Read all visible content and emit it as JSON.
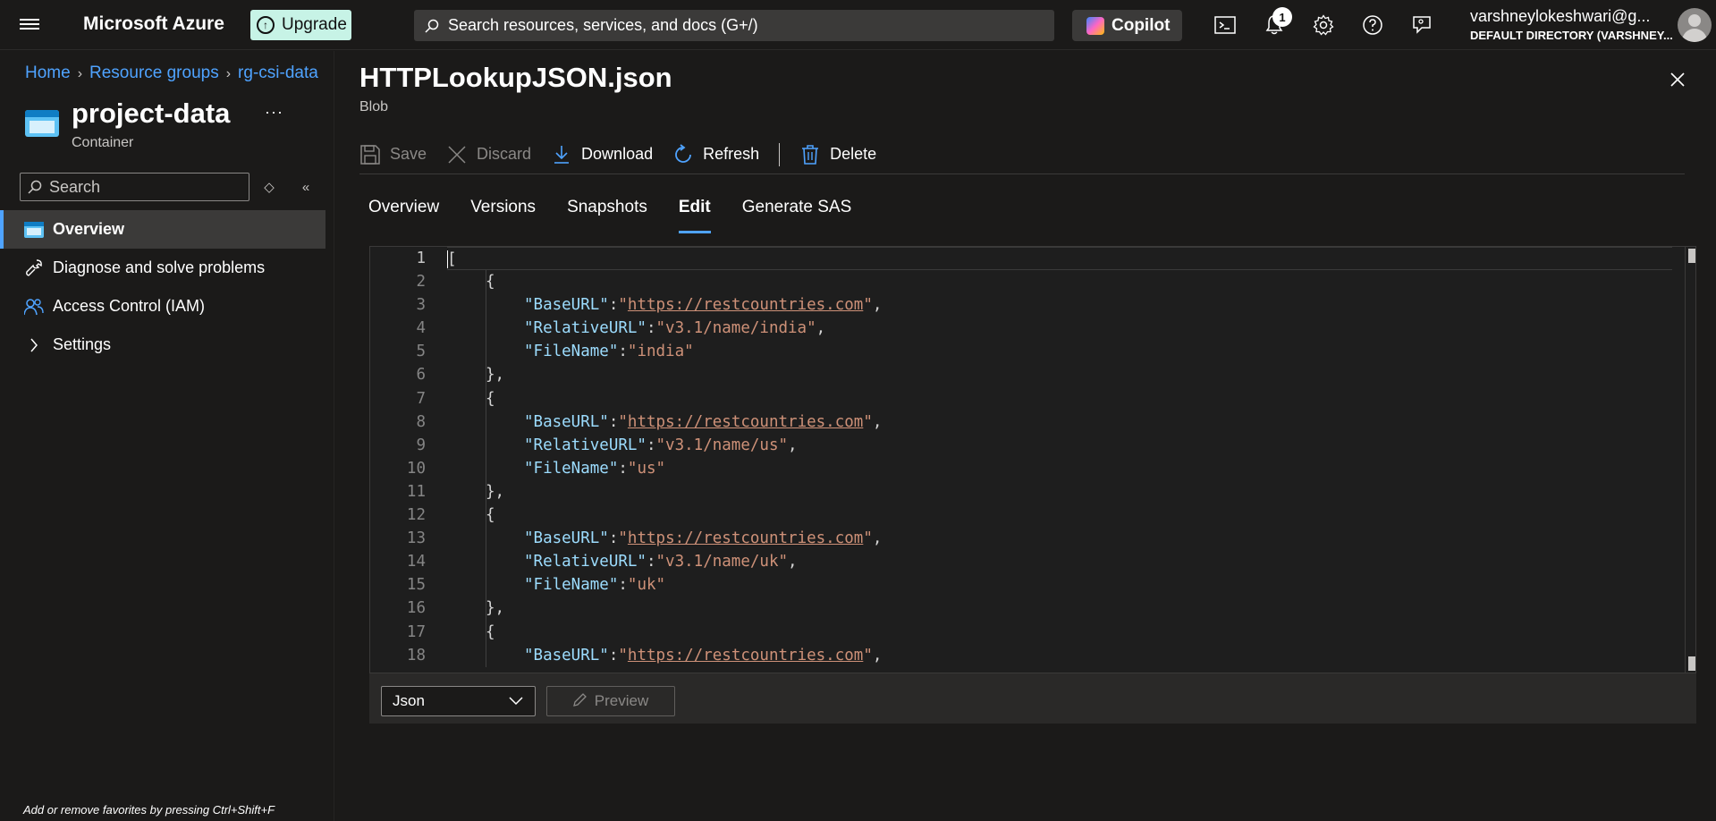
{
  "topbar": {
    "brand": "Microsoft Azure",
    "upgrade_label": "Upgrade",
    "search_placeholder": "Search resources, services, and docs (G+/)",
    "copilot_label": "Copilot",
    "notification_count": "1",
    "account_name": "varshneylokeshwari@g...",
    "account_directory": "DEFAULT DIRECTORY (VARSHNEY..."
  },
  "left": {
    "breadcrumb": [
      "Home",
      "Resource groups",
      "rg-csi-data"
    ],
    "resource_title": "project-data",
    "resource_type": "Container",
    "more": "···",
    "search_placeholder": "Search",
    "menu": [
      {
        "label": "Overview",
        "icon": "container-icon",
        "active": true
      },
      {
        "label": "Diagnose and solve problems",
        "icon": "wrench-icon",
        "active": false
      },
      {
        "label": "Access Control (IAM)",
        "icon": "people-icon",
        "active": false
      },
      {
        "label": "Settings",
        "icon": "chevron-right-icon",
        "active": false
      }
    ],
    "favorites_hint": "Add or remove favorites by pressing Ctrl+Shift+F"
  },
  "blob": {
    "title": "HTTPLookupJSON.json",
    "subtitle": "Blob",
    "toolbar": {
      "save": "Save",
      "discard": "Discard",
      "download": "Download",
      "refresh": "Refresh",
      "delete": "Delete"
    },
    "tabs": [
      "Overview",
      "Versions",
      "Snapshots",
      "Edit",
      "Generate SAS"
    ],
    "active_tab": "Edit",
    "language": "Json",
    "preview": "Preview"
  },
  "editor": {
    "current_line": 1,
    "lines": [
      {
        "n": "1",
        "parts": [
          [
            "p",
            "["
          ]
        ],
        "indent": 0
      },
      {
        "n": "2",
        "parts": [
          [
            "p",
            "{"
          ]
        ],
        "indent": 1
      },
      {
        "n": "3",
        "parts": [
          [
            "k",
            "\"BaseURL\""
          ],
          [
            "p",
            ":"
          ],
          [
            "s",
            "\""
          ],
          [
            "u",
            "https://restcountries.com"
          ],
          [
            "s",
            "\""
          ],
          [
            "p",
            ","
          ]
        ],
        "indent": 2
      },
      {
        "n": "4",
        "parts": [
          [
            "k",
            "\"RelativeURL\""
          ],
          [
            "p",
            ":"
          ],
          [
            "s",
            "\"v3.1/name/india\""
          ],
          [
            "p",
            ","
          ]
        ],
        "indent": 2
      },
      {
        "n": "5",
        "parts": [
          [
            "k",
            "\"FileName\""
          ],
          [
            "p",
            ":"
          ],
          [
            "s",
            "\"india\""
          ]
        ],
        "indent": 2
      },
      {
        "n": "6",
        "parts": [
          [
            "p",
            "},"
          ]
        ],
        "indent": 1
      },
      {
        "n": "7",
        "parts": [
          [
            "p",
            "{"
          ]
        ],
        "indent": 1
      },
      {
        "n": "8",
        "parts": [
          [
            "k",
            "\"BaseURL\""
          ],
          [
            "p",
            ":"
          ],
          [
            "s",
            "\""
          ],
          [
            "u",
            "https://restcountries.com"
          ],
          [
            "s",
            "\""
          ],
          [
            "p",
            ","
          ]
        ],
        "indent": 2
      },
      {
        "n": "9",
        "parts": [
          [
            "k",
            "\"RelativeURL\""
          ],
          [
            "p",
            ":"
          ],
          [
            "s",
            "\"v3.1/name/us\""
          ],
          [
            "p",
            ","
          ]
        ],
        "indent": 2
      },
      {
        "n": "10",
        "parts": [
          [
            "k",
            "\"FileName\""
          ],
          [
            "p",
            ":"
          ],
          [
            "s",
            "\"us\""
          ]
        ],
        "indent": 2
      },
      {
        "n": "11",
        "parts": [
          [
            "p",
            "},"
          ]
        ],
        "indent": 1
      },
      {
        "n": "12",
        "parts": [
          [
            "p",
            "{"
          ]
        ],
        "indent": 1
      },
      {
        "n": "13",
        "parts": [
          [
            "k",
            "\"BaseURL\""
          ],
          [
            "p",
            ":"
          ],
          [
            "s",
            "\""
          ],
          [
            "u",
            "https://restcountries.com"
          ],
          [
            "s",
            "\""
          ],
          [
            "p",
            ","
          ]
        ],
        "indent": 2
      },
      {
        "n": "14",
        "parts": [
          [
            "k",
            "\"RelativeURL\""
          ],
          [
            "p",
            ":"
          ],
          [
            "s",
            "\"v3.1/name/uk\""
          ],
          [
            "p",
            ","
          ]
        ],
        "indent": 2
      },
      {
        "n": "15",
        "parts": [
          [
            "k",
            "\"FileName\""
          ],
          [
            "p",
            ":"
          ],
          [
            "s",
            "\"uk\""
          ]
        ],
        "indent": 2
      },
      {
        "n": "16",
        "parts": [
          [
            "p",
            "},"
          ]
        ],
        "indent": 1
      },
      {
        "n": "17",
        "parts": [
          [
            "p",
            "{"
          ]
        ],
        "indent": 1
      },
      {
        "n": "18",
        "parts": [
          [
            "k",
            "\"BaseURL\""
          ],
          [
            "p",
            ":"
          ],
          [
            "s",
            "\""
          ],
          [
            "u",
            "https://restcountries.com"
          ],
          [
            "s",
            "\""
          ],
          [
            "p",
            ","
          ]
        ],
        "indent": 2
      }
    ]
  },
  "colors": {
    "accent": "#4fa3ff",
    "json_key": "#9cdcfe",
    "json_string": "#ce9178",
    "upgrade_bg": "#c7f3e6"
  }
}
